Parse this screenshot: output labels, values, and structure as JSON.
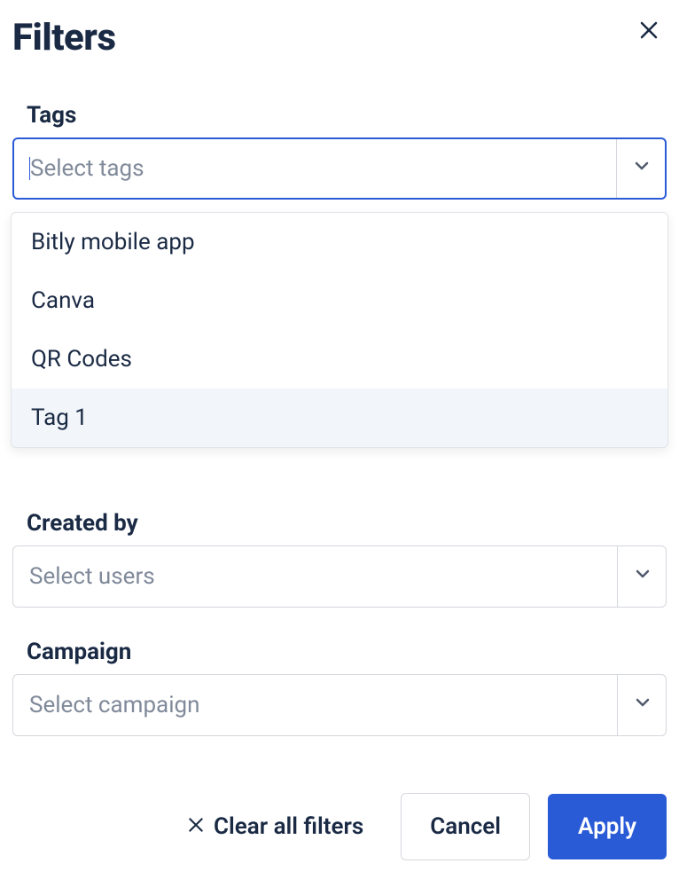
{
  "title": "Filters",
  "fields": {
    "tags": {
      "label": "Tags",
      "placeholder": "Select tags",
      "options": [
        "Bitly mobile app",
        "Canva",
        "QR Codes",
        "Tag 1"
      ],
      "highlighted_index": 3
    },
    "created_by": {
      "label": "Created by",
      "placeholder": "Select users"
    },
    "campaign": {
      "label": "Campaign",
      "placeholder": "Select campaign"
    }
  },
  "footer": {
    "clear_label": "Clear all filters",
    "cancel_label": "Cancel",
    "apply_label": "Apply"
  }
}
